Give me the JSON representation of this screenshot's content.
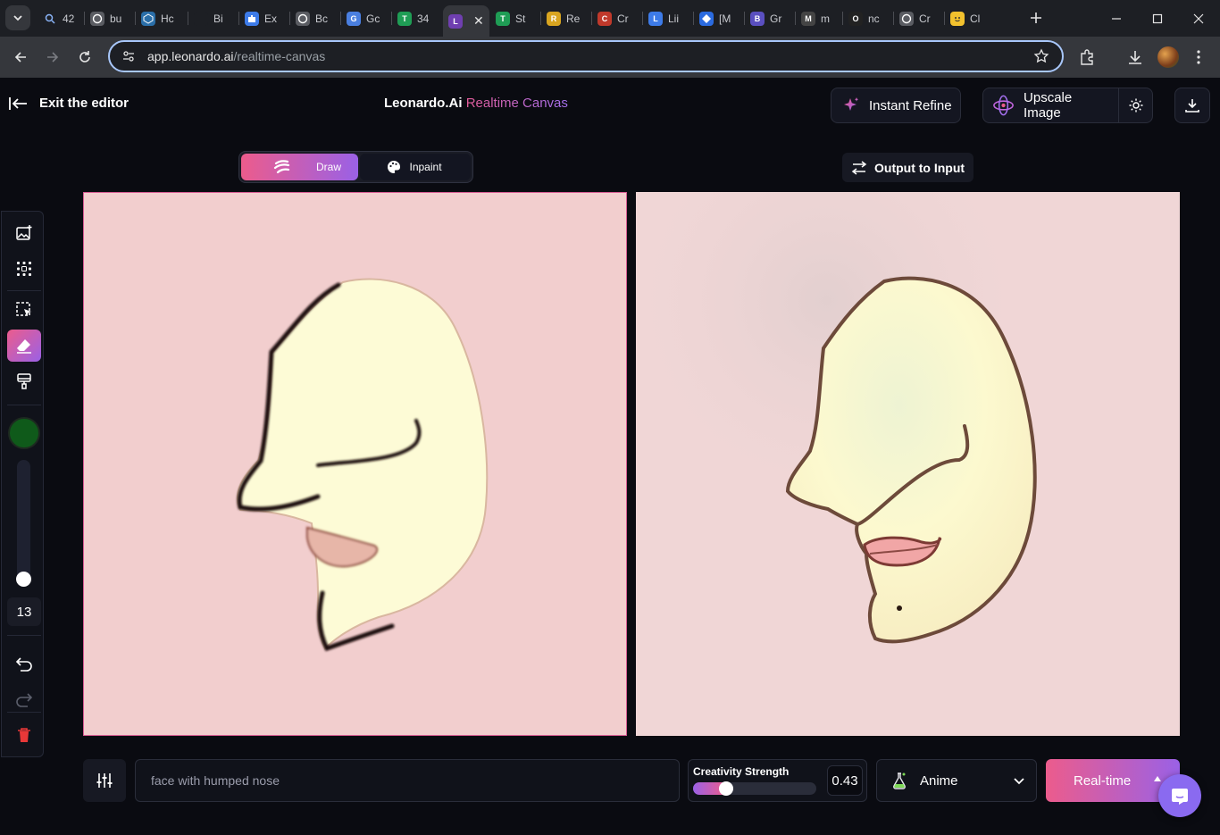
{
  "browser": {
    "tabs": [
      {
        "label": "42",
        "fav_color": "#1d1f24",
        "fav_glyph": "search"
      },
      {
        "label": "bu",
        "fav_color": "#5a5c62",
        "fav_glyph": "circle"
      },
      {
        "label": "Hc",
        "fav_color": "#2a6ea8",
        "fav_glyph": "box"
      },
      {
        "label": "Bi",
        "fav_color": "#1d1f24",
        "fav_glyph": "none"
      },
      {
        "label": "Ex",
        "fav_color": "#3d7be8",
        "fav_glyph": "puzzle"
      },
      {
        "label": "Bc",
        "fav_color": "#5a5c62",
        "fav_glyph": "gear"
      },
      {
        "label": "Gc",
        "fav_color": "#4a7fe0",
        "fav_glyph": "G"
      },
      {
        "label": "34",
        "fav_color": "#1f9d55",
        "fav_glyph": "T"
      },
      {
        "label": "",
        "fav_color": "#6f3fb0",
        "fav_glyph": "L",
        "active": true
      },
      {
        "label": "St",
        "fav_color": "#1f9d55",
        "fav_glyph": "T"
      },
      {
        "label": "Re",
        "fav_color": "#d9a520",
        "fav_glyph": "R"
      },
      {
        "label": "Cr",
        "fav_color": "#c0392b",
        "fav_glyph": "C"
      },
      {
        "label": "Lii",
        "fav_color": "#3d7be8",
        "fav_glyph": "L"
      },
      {
        "label": "[M",
        "fav_color": "#2b6be0",
        "fav_glyph": "diamond"
      },
      {
        "label": "Gr",
        "fav_color": "#5a4fc0",
        "fav_glyph": "B"
      },
      {
        "label": "m",
        "fav_color": "#444",
        "fav_glyph": "M"
      },
      {
        "label": "nc",
        "fav_color": "#222",
        "fav_glyph": "O"
      },
      {
        "label": "Cr",
        "fav_color": "#5a5c62",
        "fav_glyph": "globe"
      },
      {
        "label": "Cl",
        "fav_color": "#f2c12e",
        "fav_glyph": "smile"
      }
    ],
    "url_host": "app.leonardo.ai",
    "url_path": "/realtime-canvas"
  },
  "header": {
    "exit_label": "Exit the editor",
    "title_main": "Leonardo.Ai",
    "title_accent": "Realtime Canvas",
    "instant_refine_label": "Instant Refine",
    "upscale_label": "Upscale Image"
  },
  "modes": {
    "draw_label": "Draw",
    "inpaint_label": "Inpaint",
    "active": "Draw"
  },
  "output_to_input_label": "Output to Input",
  "tools": {
    "brush_color": "#0f5a1a",
    "brush_size": "13",
    "brush_size_fraction": 0.1
  },
  "bottom": {
    "prompt_text": "face with humped nose",
    "creativity_label": "Creativity Strength",
    "creativity_value": "0.43",
    "creativity_fraction": 0.21,
    "style_label": "Anime",
    "realtime_label": "Real-time"
  },
  "colors": {
    "accent_pink": "#ec5c8c",
    "accent_purple": "#9a61e6",
    "canvas_left_bg": "#f2cece",
    "canvas_right_bg": "#f0d6d6"
  }
}
